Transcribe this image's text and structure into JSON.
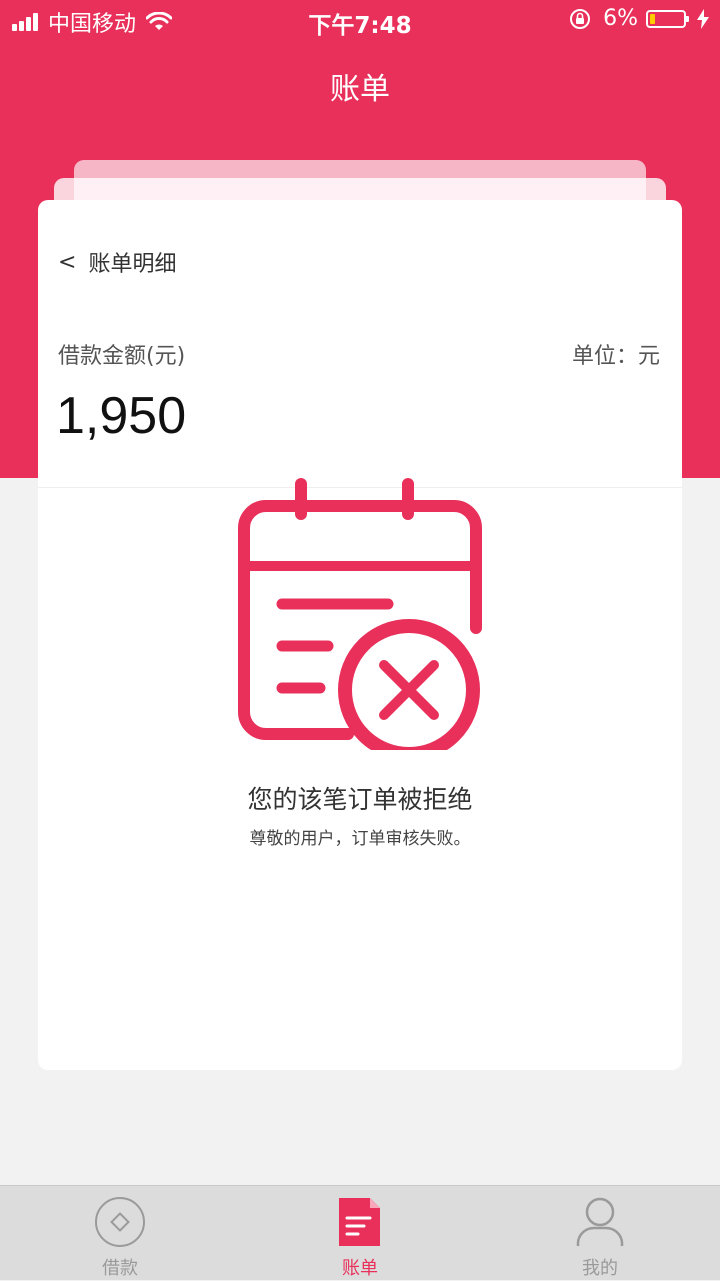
{
  "status_bar": {
    "carrier": "中国移动",
    "time": "下午7:48",
    "battery_percent": "6%",
    "battery_level": 0.06,
    "accent_battery_color": "#ffcc00"
  },
  "header": {
    "title": "账单",
    "background_color": "#e8305a"
  },
  "card": {
    "back_label": "账单明细",
    "back_chevron": "<",
    "amount_label": "借款金额(元)",
    "unit_label": "单位：元",
    "amount_value": "1,950"
  },
  "empty_state": {
    "icon": "calendar-reject-icon",
    "title": "您的该笔订单被拒绝",
    "description": "尊敬的用户，订单审核失败。"
  },
  "tab_bar": {
    "tabs": [
      {
        "label": "借款",
        "icon": "diamond-circle-icon",
        "active": false
      },
      {
        "label": "账单",
        "icon": "document-icon",
        "active": true
      },
      {
        "label": "我的",
        "icon": "person-icon",
        "active": false
      }
    ],
    "active_color": "#e8305a",
    "inactive_color": "#9a9a9a"
  }
}
